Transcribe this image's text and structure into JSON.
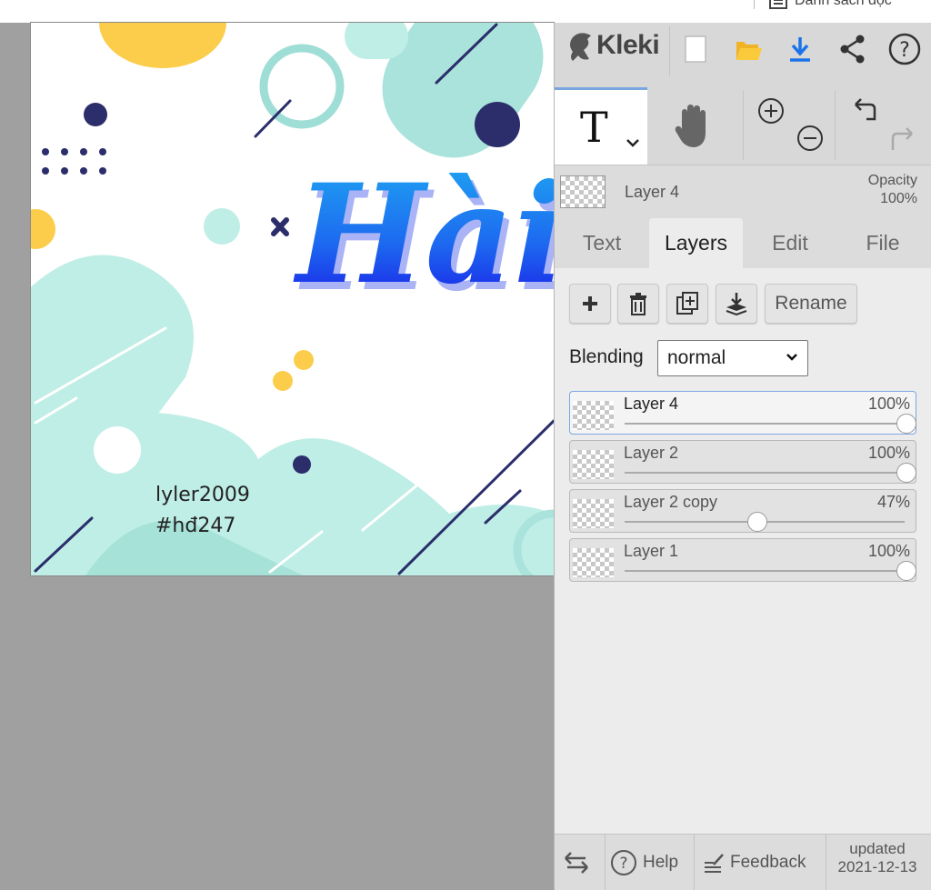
{
  "topbar": {
    "reading_list_label": "Danh sách đọc"
  },
  "canvas": {
    "title_text": "Hài",
    "credit_line1": "lyler2009",
    "credit_line2": "#hđ247"
  },
  "app": {
    "name": "Kleki",
    "header_icons": [
      "new-image-icon",
      "open-folder-icon",
      "download-icon",
      "share-icon",
      "help-icon"
    ],
    "accent_color": "#1a73e8"
  },
  "tools": {
    "active": "text",
    "items": [
      "text-tool-icon",
      "hand-tool-icon",
      "zoom-in-icon",
      "zoom-out-icon",
      "undo-icon",
      "redo-icon"
    ]
  },
  "current_layer": {
    "name": "Layer 4",
    "opacity_label": "Opacity",
    "opacity_value": "100%"
  },
  "tabs": [
    {
      "label": "Text",
      "active": false
    },
    {
      "label": "Layers",
      "active": true
    },
    {
      "label": "Edit",
      "active": false
    },
    {
      "label": "File",
      "active": false
    }
  ],
  "layer_actions": {
    "add_icon": "plus-icon",
    "delete_icon": "trash-icon",
    "duplicate_icon": "duplicate-icon",
    "merge_icon": "merge-down-icon",
    "rename_label": "Rename"
  },
  "blending": {
    "label": "Blending",
    "value": "normal"
  },
  "layers": [
    {
      "name": "Layer 4",
      "opacity_label": "100%",
      "opacity": 1.0,
      "active": true
    },
    {
      "name": "Layer 2",
      "opacity_label": "100%",
      "opacity": 1.0,
      "active": false
    },
    {
      "name": "Layer 2 copy",
      "opacity_label": "47%",
      "opacity": 0.47,
      "active": false
    },
    {
      "name": "Layer 1",
      "opacity_label": "100%",
      "opacity": 1.0,
      "active": false
    }
  ],
  "footer": {
    "help_label": "Help",
    "feedback_label": "Feedback",
    "updated_label": "updated",
    "updated_date": "2021-12-13"
  }
}
